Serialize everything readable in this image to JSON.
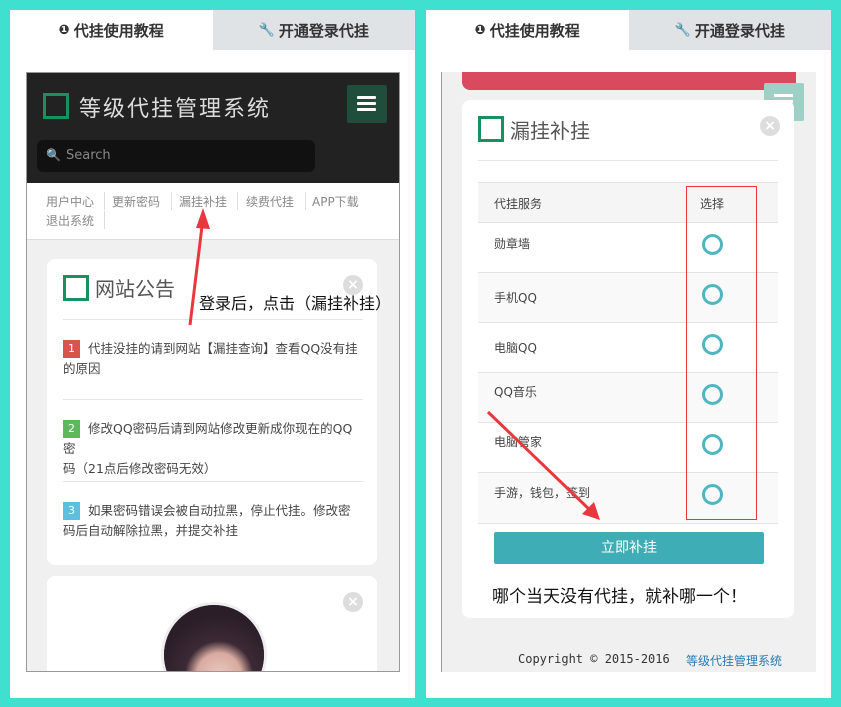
{
  "tabs": {
    "tutorial": "代挂使用教程",
    "open_login": "开通登录代挂"
  },
  "left": {
    "brand": "等级代挂管理系统",
    "search_placeholder": "Search",
    "nav": [
      "用户中心",
      "更新密码",
      "漏挂补挂",
      "续费代挂",
      "APP下载",
      "退出系统"
    ],
    "notice_title": "网站公告",
    "notices": [
      {
        "num": "1",
        "color": "#d9534f",
        "line1": "代挂没挂的请到网站【漏挂查询】查看QQ没有挂",
        "line2": "的原因"
      },
      {
        "num": "2",
        "color": "#5cb85c",
        "line1": "修改QQ密码后请到网站修改更新成你现在的QQ密",
        "line2": "码（21点后修改密码无效）"
      },
      {
        "num": "3",
        "color": "#5bc0de",
        "line1": "如果密码错误会被自动拉黑，停止代挂。修改密",
        "line2": "码后自动解除拉黑，并提交补挂"
      }
    ],
    "annotation": "登录后，点击（漏挂补挂）"
  },
  "right": {
    "card_title": "漏挂补挂",
    "table_headers": {
      "service": "代挂服务",
      "select": "选择"
    },
    "services": [
      "勋章墙",
      "手机QQ",
      "电脑QQ",
      "QQ音乐",
      "电脑管家",
      "手游，钱包，签到"
    ],
    "submit_label": "立即补挂",
    "annotation": "哪个当天没有代挂，就补哪一个！",
    "copyright": "Copyright © 2015-2016",
    "footer_link": "等级代挂管理系统"
  },
  "colors": {
    "accent_teal": "#3fadb5",
    "annotation_red": "#e8383d",
    "page_bg": "#40e0d0"
  }
}
